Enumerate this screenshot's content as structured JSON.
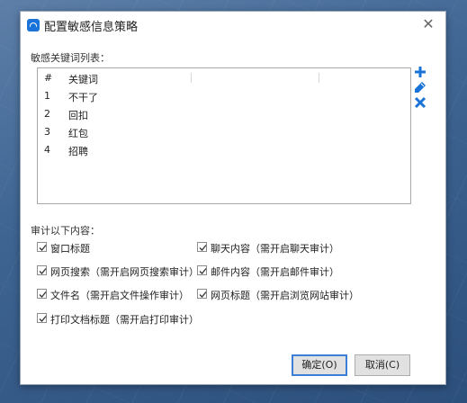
{
  "window": {
    "title": "配置敏感信息策略",
    "close_glyph": "✕"
  },
  "keywords": {
    "label": "敏感关键词列表：",
    "columns": {
      "index": "#",
      "keyword": "关键词"
    },
    "rows": [
      {
        "index": "1",
        "keyword": "不干了"
      },
      {
        "index": "2",
        "keyword": "回扣"
      },
      {
        "index": "3",
        "keyword": "红包"
      },
      {
        "index": "4",
        "keyword": "招聘"
      }
    ]
  },
  "tools": {
    "add_icon": "plus-icon",
    "edit_icon": "pencil-icon",
    "delete_icon": "x-icon",
    "accent": "#1a73d9"
  },
  "audit": {
    "label": "审计以下内容：",
    "options": [
      {
        "label": "窗口标题",
        "checked": true
      },
      {
        "label": "聊天内容（需开启聊天审计）",
        "checked": true
      },
      {
        "label": "网页搜索（需开启网页搜索审计）",
        "checked": true
      },
      {
        "label": "邮件内容（需开启邮件审计）",
        "checked": true
      },
      {
        "label": "文件名（需开启文件操作审计）",
        "checked": true
      },
      {
        "label": "网页标题（需开启浏览网站审计）",
        "checked": true
      },
      {
        "label": "打印文档标题（需开启打印审计）",
        "checked": true
      }
    ]
  },
  "buttons": {
    "ok": "确定(O)",
    "cancel": "取消(C)"
  }
}
